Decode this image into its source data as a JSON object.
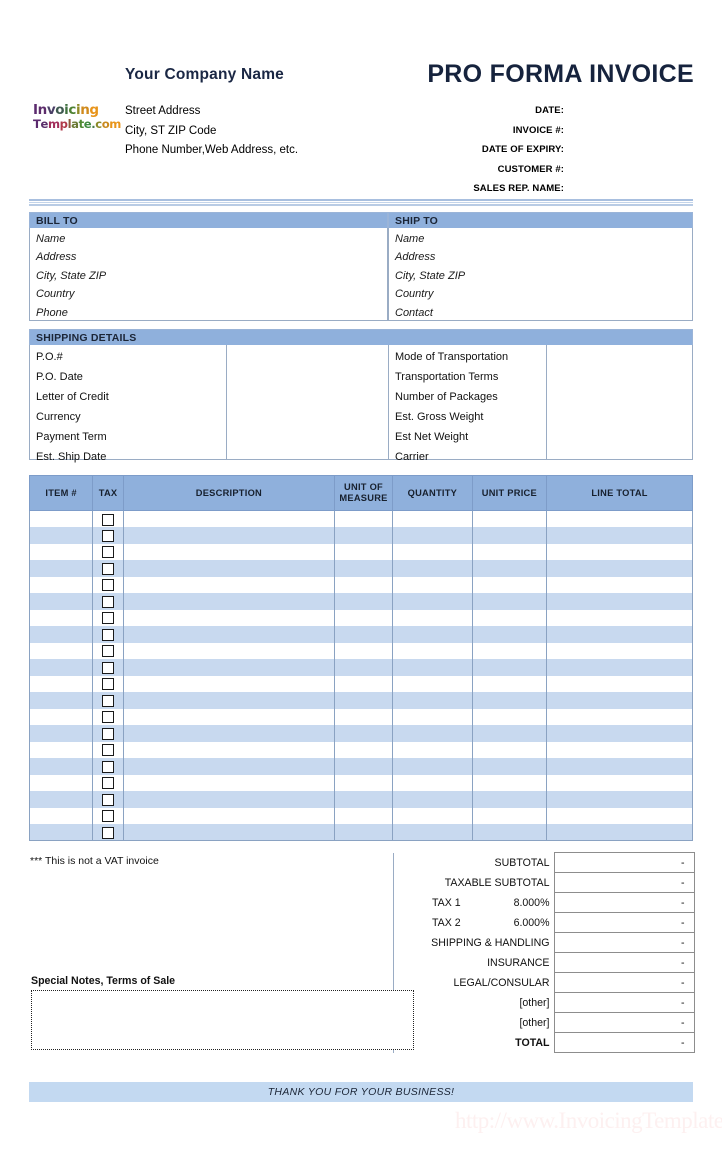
{
  "theme": {
    "band_blue": "#8fb0dc",
    "stripe_blue": "#c8d9ef",
    "footer_blue": "#c3d9f1",
    "title_navy": "#16233d",
    "watermark_pink": "#fdf0f0"
  },
  "header": {
    "company_name": "Your Company Name",
    "logo": {
      "line1": "Invoicing",
      "line2": "Template.com",
      "line1_letters": [
        {
          "ch": "I",
          "color": "#5b2a6e"
        },
        {
          "ch": "n",
          "color": "#5d2d6c"
        },
        {
          "ch": "v",
          "color": "#4a3f66"
        },
        {
          "ch": "o",
          "color": "#3f5a50"
        },
        {
          "ch": "i",
          "color": "#3f7040"
        },
        {
          "ch": "c",
          "color": "#4e8233"
        },
        {
          "ch": "i",
          "color": "#8f8a26"
        },
        {
          "ch": "n",
          "color": "#d08a1c"
        },
        {
          "ch": "g",
          "color": "#e8941a"
        }
      ],
      "line2_letters": [
        {
          "ch": "T",
          "color": "#5b2a6e"
        },
        {
          "ch": "e",
          "color": "#5b2f6b"
        },
        {
          "ch": "m",
          "color": "#a32f5c"
        },
        {
          "ch": "p",
          "color": "#b03a4a"
        },
        {
          "ch": "l",
          "color": "#8a5a3a"
        },
        {
          "ch": "a",
          "color": "#6b7a34"
        },
        {
          "ch": "t",
          "color": "#4f8a33"
        },
        {
          "ch": "e",
          "color": "#3f8a3f"
        },
        {
          "ch": ".",
          "color": "#4a7a4a"
        },
        {
          "ch": "c",
          "color": "#8a8a28"
        },
        {
          "ch": "o",
          "color": "#c98a1e"
        },
        {
          "ch": "m",
          "color": "#e8941a"
        }
      ]
    },
    "address_lines": [
      "Street Address",
      "City, ST  ZIP Code",
      "Phone Number,Web Address, etc."
    ],
    "invoice_title": "PRO FORMA INVOICE",
    "meta_labels": [
      "DATE:",
      "INVOICE #:",
      "DATE OF EXPIRY:",
      "CUSTOMER #:",
      "SALES REP. NAME:"
    ]
  },
  "bill_to": {
    "heading": "BILL TO",
    "fields": [
      "Name",
      "Address",
      "City, State ZIP",
      "Country",
      "Phone"
    ]
  },
  "ship_to": {
    "heading": "SHIP TO",
    "fields": [
      "Name",
      "Address",
      "City, State ZIP",
      "Country",
      "Contact"
    ]
  },
  "shipping_details": {
    "heading": "SHIPPING DETAILS",
    "left_labels": [
      "P.O.#",
      "P.O. Date",
      "Letter of Credit",
      "Currency",
      "Payment Term",
      "Est. Ship Date"
    ],
    "right_labels": [
      "Mode of Transportation",
      "Transportation Terms",
      "Number of Packages",
      "Est. Gross Weight",
      "Est Net Weight",
      "Carrier"
    ]
  },
  "items_table": {
    "columns": [
      "ITEM #",
      "TAX",
      "DESCRIPTION",
      "UNIT OF MEASURE",
      "QUANTITY",
      "UNIT PRICE",
      "LINE TOTAL"
    ],
    "unit_of_measure_line1": "UNIT OF",
    "unit_of_measure_line2": "MEASURE",
    "row_count": 20,
    "rows": [
      {
        "item": "",
        "tax": false,
        "description": "",
        "uom": "",
        "quantity": "",
        "unit_price": "",
        "line_total": ""
      },
      {
        "item": "",
        "tax": false,
        "description": "",
        "uom": "",
        "quantity": "",
        "unit_price": "",
        "line_total": ""
      },
      {
        "item": "",
        "tax": false,
        "description": "",
        "uom": "",
        "quantity": "",
        "unit_price": "",
        "line_total": ""
      },
      {
        "item": "",
        "tax": false,
        "description": "",
        "uom": "",
        "quantity": "",
        "unit_price": "",
        "line_total": ""
      },
      {
        "item": "",
        "tax": false,
        "description": "",
        "uom": "",
        "quantity": "",
        "unit_price": "",
        "line_total": ""
      },
      {
        "item": "",
        "tax": false,
        "description": "",
        "uom": "",
        "quantity": "",
        "unit_price": "",
        "line_total": ""
      },
      {
        "item": "",
        "tax": false,
        "description": "",
        "uom": "",
        "quantity": "",
        "unit_price": "",
        "line_total": ""
      },
      {
        "item": "",
        "tax": false,
        "description": "",
        "uom": "",
        "quantity": "",
        "unit_price": "",
        "line_total": ""
      },
      {
        "item": "",
        "tax": false,
        "description": "",
        "uom": "",
        "quantity": "",
        "unit_price": "",
        "line_total": ""
      },
      {
        "item": "",
        "tax": false,
        "description": "",
        "uom": "",
        "quantity": "",
        "unit_price": "",
        "line_total": ""
      },
      {
        "item": "",
        "tax": false,
        "description": "",
        "uom": "",
        "quantity": "",
        "unit_price": "",
        "line_total": ""
      },
      {
        "item": "",
        "tax": false,
        "description": "",
        "uom": "",
        "quantity": "",
        "unit_price": "",
        "line_total": ""
      },
      {
        "item": "",
        "tax": false,
        "description": "",
        "uom": "",
        "quantity": "",
        "unit_price": "",
        "line_total": ""
      },
      {
        "item": "",
        "tax": false,
        "description": "",
        "uom": "",
        "quantity": "",
        "unit_price": "",
        "line_total": ""
      },
      {
        "item": "",
        "tax": false,
        "description": "",
        "uom": "",
        "quantity": "",
        "unit_price": "",
        "line_total": ""
      },
      {
        "item": "",
        "tax": false,
        "description": "",
        "uom": "",
        "quantity": "",
        "unit_price": "",
        "line_total": ""
      },
      {
        "item": "",
        "tax": false,
        "description": "",
        "uom": "",
        "quantity": "",
        "unit_price": "",
        "line_total": ""
      },
      {
        "item": "",
        "tax": false,
        "description": "",
        "uom": "",
        "quantity": "",
        "unit_price": "",
        "line_total": ""
      },
      {
        "item": "",
        "tax": false,
        "description": "",
        "uom": "",
        "quantity": "",
        "unit_price": "",
        "line_total": ""
      },
      {
        "item": "",
        "tax": false,
        "description": "",
        "uom": "",
        "quantity": "",
        "unit_price": "",
        "line_total": ""
      }
    ]
  },
  "vat_note": "*** This is not a VAT invoice",
  "totals": [
    {
      "label": "SUBTOTAL",
      "rate": "",
      "value": "-",
      "bold": false
    },
    {
      "label": "TAXABLE SUBTOTAL",
      "rate": "",
      "value": "-",
      "bold": false
    },
    {
      "label": "TAX 1",
      "rate": "8.000%",
      "value": "-",
      "bold": false
    },
    {
      "label": "TAX 2",
      "rate": "6.000%",
      "value": "-",
      "bold": false
    },
    {
      "label": "SHIPPING & HANDLING",
      "rate": "",
      "value": "-",
      "bold": false
    },
    {
      "label": "INSURANCE",
      "rate": "",
      "value": "-",
      "bold": false
    },
    {
      "label": "LEGAL/CONSULAR",
      "rate": "",
      "value": "-",
      "bold": false
    },
    {
      "label": "[other]",
      "rate": "",
      "value": "-",
      "bold": false
    },
    {
      "label": "[other]",
      "rate": "",
      "value": "-",
      "bold": false
    },
    {
      "label": "TOTAL",
      "rate": "",
      "value": "-",
      "bold": true
    }
  ],
  "notes": {
    "title": "Special Notes, Terms of Sale",
    "value": "",
    "placeholder": ""
  },
  "footer": {
    "thanks": "THANK YOU FOR YOUR BUSINESS!",
    "watermark": "http://www.InvoicingTemplate.com"
  }
}
